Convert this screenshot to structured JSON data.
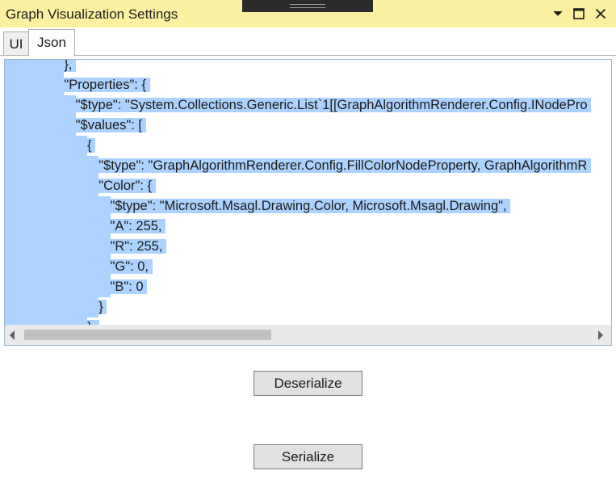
{
  "window": {
    "title": "Graph Visualization Settings"
  },
  "titlebar_buttons": {
    "pin_icon": "chevron-down-icon",
    "maximize_icon": "maximize-icon",
    "close_icon": "close-icon"
  },
  "tabs": [
    {
      "label": "UI",
      "active": false
    },
    {
      "label": "Json",
      "active": true
    }
  ],
  "editor": {
    "lines": [
      {
        "indent": "          ",
        "text": "},"
      },
      {
        "indent": "          ",
        "text": "\"Properties\": {"
      },
      {
        "indent": "            ",
        "text": "\"$type\": \"System.Collections.Generic.List`1[[GraphAlgorithmRenderer.Config.INodePro"
      },
      {
        "indent": "            ",
        "text": "\"$values\": ["
      },
      {
        "indent": "              ",
        "text": "{"
      },
      {
        "indent": "                ",
        "text": "\"$type\": \"GraphAlgorithmRenderer.Config.FillColorNodeProperty, GraphAlgorithmR"
      },
      {
        "indent": "                ",
        "text": "\"Color\": {"
      },
      {
        "indent": "                  ",
        "text": "\"$type\": \"Microsoft.Msagl.Drawing.Color, Microsoft.Msagl.Drawing\","
      },
      {
        "indent": "                  ",
        "text": "\"A\": 255,"
      },
      {
        "indent": "                  ",
        "text": "\"R\": 255,"
      },
      {
        "indent": "                  ",
        "text": "\"G\": 0,"
      },
      {
        "indent": "                  ",
        "text": "\"B\": 0"
      },
      {
        "indent": "                ",
        "text": "}"
      },
      {
        "indent": "              ",
        "text": "},"
      }
    ],
    "selection_color": "#acd3ff"
  },
  "buttons": {
    "deserialize_label": "Deserialize",
    "serialize_label": "Serialize"
  },
  "colors": {
    "titlebar": "#fcf1a2",
    "selection": "#acd3ff",
    "button_face": "#e1e1e1"
  }
}
